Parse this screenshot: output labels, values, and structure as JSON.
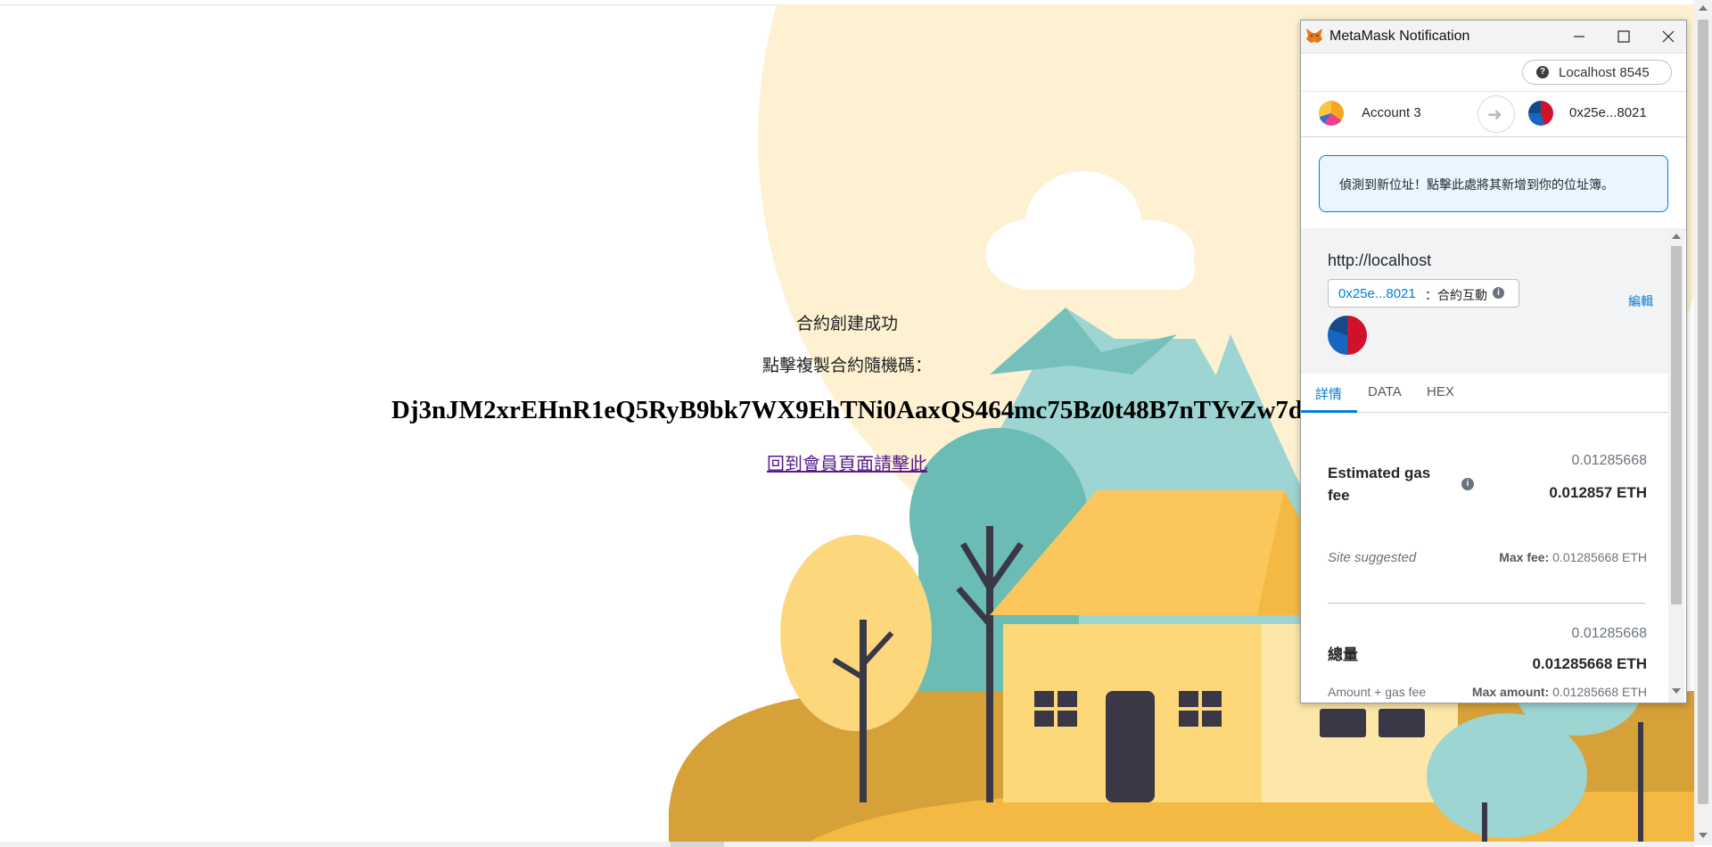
{
  "page": {
    "success_message": "合約創建成功",
    "copy_prompt": "點擊複製合約隨機碼：",
    "contract_code": "Dj3nJM2xrEHnR1eQ5RyB9bk7WX9EhTNi0AaxQS464mc75Bz0t48B7nTYvZw7d",
    "back_link": "回到會員頁面請擊此"
  },
  "metamask": {
    "window_title": "MetaMask Notification",
    "network": "Localhost 8545",
    "from_account": "Account 3",
    "to_account": "0x25e...8021",
    "new_address_notice": "偵測到新位址！點擊此處將其新增到你的位址簿。",
    "origin": "http://localhost",
    "method": {
      "address": "0x25e...8021",
      "label": "：合約互動"
    },
    "tabs": [
      "詳情",
      "DATA",
      "HEX"
    ],
    "edit_label": "編輯",
    "gas": {
      "label": "Estimated gas fee",
      "value": "0.01285668",
      "value_eth": "0.012857 ETH",
      "suggested": "Site suggested",
      "max_fee_label": "Max fee:",
      "max_fee_value": "0.01285668 ETH"
    },
    "total": {
      "label": "總量",
      "value": "0.01285668",
      "value_eth": "0.01285668 ETH",
      "sub_label": "Amount + gas fee",
      "max_amount_label": "Max amount:",
      "max_amount_value": "0.01285668 ETH"
    }
  },
  "colors": {
    "accent": "#037dd6",
    "link_visited": "#551a8b"
  }
}
